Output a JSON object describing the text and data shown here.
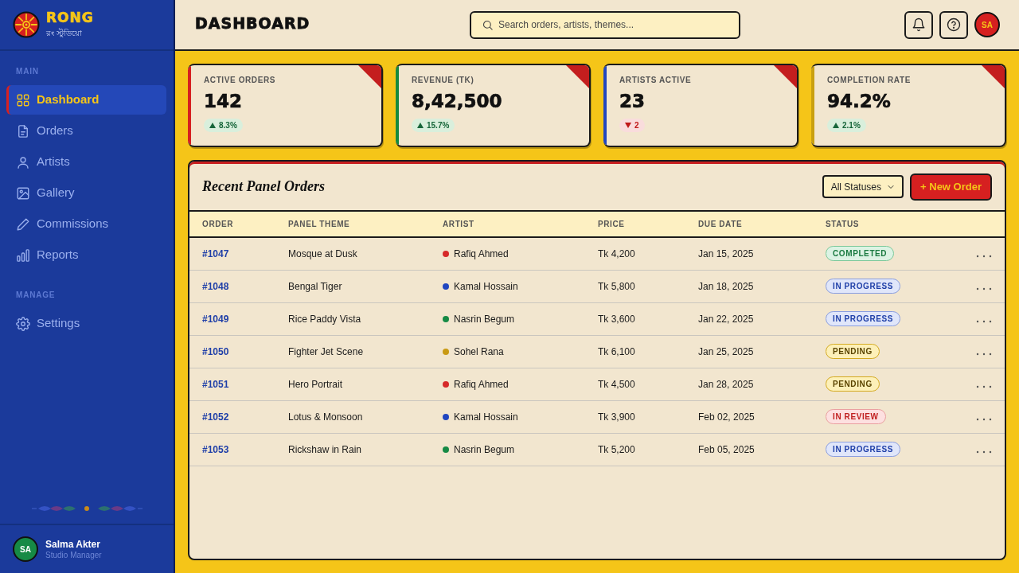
{
  "sidebar": {
    "brand": {
      "name": "RONG",
      "subtitle": "রং স্টুডিয়ো"
    },
    "sections": [
      {
        "title": "MAIN",
        "items": [
          {
            "label": "Dashboard",
            "selected": true
          },
          {
            "label": "Orders",
            "selected": false
          },
          {
            "label": "Artists",
            "selected": false
          },
          {
            "label": "Gallery",
            "selected": false
          },
          {
            "label": "Commissions",
            "selected": false
          },
          {
            "label": "Reports",
            "selected": false
          }
        ]
      },
      {
        "title": "MANAGE",
        "items": [
          {
            "label": "Settings",
            "selected": false
          }
        ]
      }
    ],
    "user": {
      "initials": "SA",
      "name": "Salma Akter",
      "role": "Studio Manager"
    }
  },
  "header": {
    "title": "DASHBOARD",
    "search": {
      "placeholder": "Search orders, artists, themes..."
    },
    "avatar": {
      "initials": "SA"
    }
  },
  "stats": [
    {
      "label": "ACTIVE ORDERS",
      "value": "142",
      "change": "8.3%",
      "increase": true,
      "color": "#d62020"
    },
    {
      "label": "REVENUE (TK)",
      "value": "8,42,500",
      "change": "15.7%",
      "increase": true,
      "color": "#168a3e"
    },
    {
      "label": "ARTISTS ACTIVE",
      "value": "23",
      "change": "2",
      "increase": false,
      "color": "#2146c0"
    },
    {
      "label": "COMPLETION RATE",
      "value": "94.2%",
      "change": "2.1%",
      "increase": true,
      "color": "#c9a010"
    }
  ],
  "orders": {
    "title": "Recent Panel Orders",
    "filter": "All Statuses",
    "new_button": "+ New Order",
    "columns": [
      "ORDER",
      "PANEL THEME",
      "ARTIST",
      "PRICE",
      "DUE DATE",
      "STATUS"
    ],
    "rows": [
      {
        "order": "#1047",
        "theme": "Mosque at Dusk",
        "artist": {
          "name": "Rafiq Ahmed",
          "color": "#d62a2a"
        },
        "price": "Tk 4,200",
        "due": "Jan 15, 2025",
        "status": {
          "text": "COMPLETED",
          "kind": "completed"
        }
      },
      {
        "order": "#1048",
        "theme": "Bengal Tiger",
        "artist": {
          "name": "Kamal Hossain",
          "color": "#2146c0"
        },
        "price": "Tk 5,800",
        "due": "Jan 18, 2025",
        "status": {
          "text": "IN PROGRESS",
          "kind": "progress"
        }
      },
      {
        "order": "#1049",
        "theme": "Rice Paddy Vista",
        "artist": {
          "name": "Nasrin Begum",
          "color": "#168a45"
        },
        "price": "Tk 3,600",
        "due": "Jan 22, 2025",
        "status": {
          "text": "IN PROGRESS",
          "kind": "progress"
        }
      },
      {
        "order": "#1050",
        "theme": "Fighter Jet Scene",
        "artist": {
          "name": "Sohel Rana",
          "color": "#c99a14"
        },
        "price": "Tk 6,100",
        "due": "Jan 25, 2025",
        "status": {
          "text": "PENDING",
          "kind": "pending"
        }
      },
      {
        "order": "#1051",
        "theme": "Hero Portrait",
        "artist": {
          "name": "Rafiq Ahmed",
          "color": "#d62a2a"
        },
        "price": "Tk 4,500",
        "due": "Jan 28, 2025",
        "status": {
          "text": "PENDING",
          "kind": "pending"
        }
      },
      {
        "order": "#1052",
        "theme": "Lotus & Monsoon",
        "artist": {
          "name": "Kamal Hossain",
          "color": "#2146c0"
        },
        "price": "Tk 3,900",
        "due": "Feb 02, 2025",
        "status": {
          "text": "IN REVIEW",
          "kind": "review"
        }
      },
      {
        "order": "#1053",
        "theme": "Rickshaw in Rain",
        "artist": {
          "name": "Nasrin Begum",
          "color": "#168a45"
        },
        "price": "Tk 5,200",
        "due": "Feb 05, 2025",
        "status": {
          "text": "IN PROGRESS",
          "kind": "progress"
        }
      }
    ]
  }
}
